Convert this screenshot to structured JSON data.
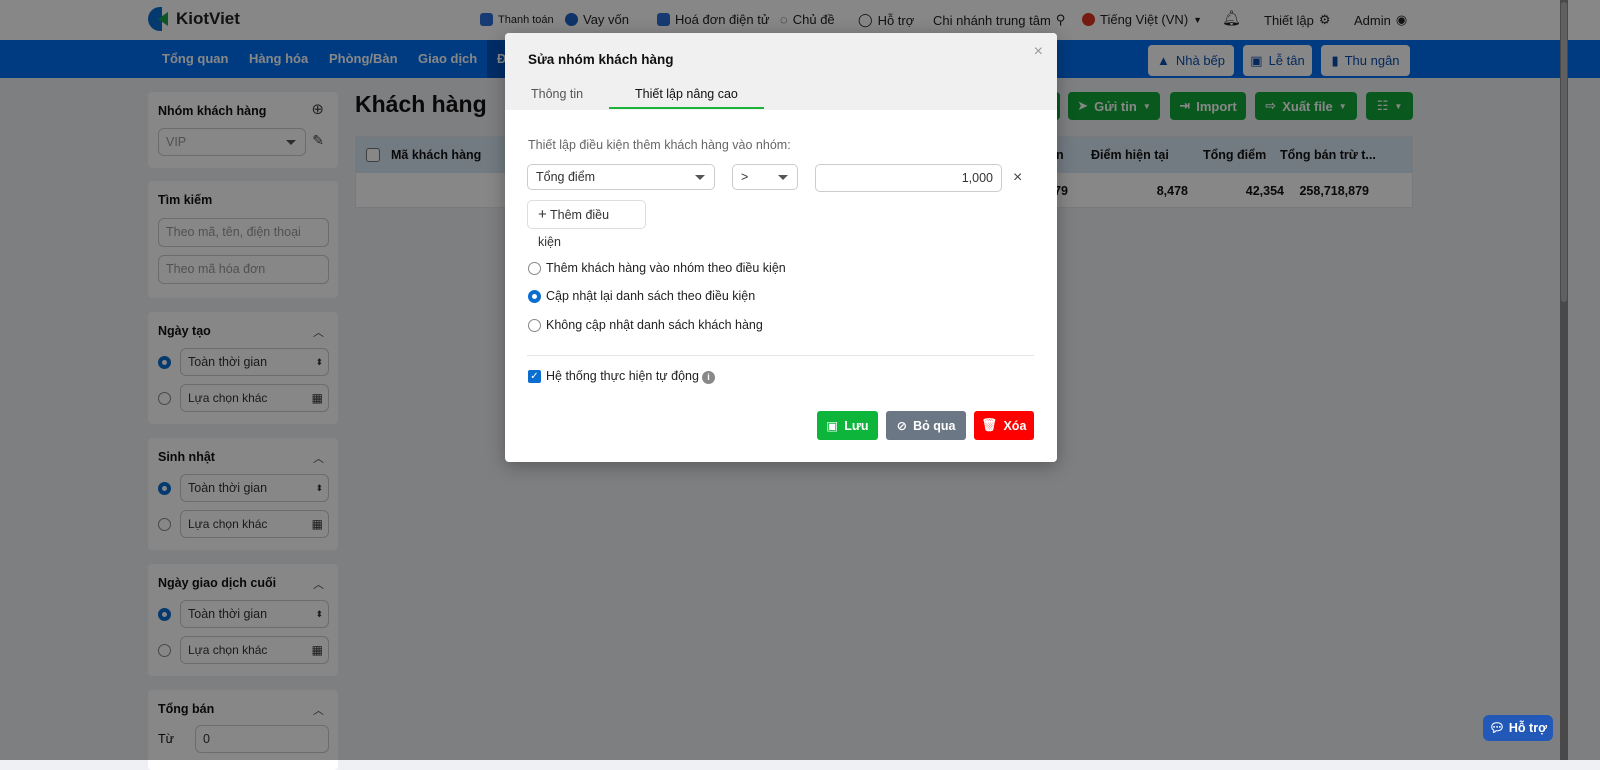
{
  "topbar": {
    "brand": "KiotViet",
    "items": [
      "Thanh toán",
      "Vay vốn",
      "Hoá đơn điện tử",
      "Chủ đề",
      "Hỗ trợ",
      "Chi nhánh trung tâm",
      "Tiếng Việt (VN)",
      "Thiết lập",
      "Admin"
    ]
  },
  "nav": {
    "items": [
      "Tổng quan",
      "Hàng hóa",
      "Phòng/Bàn",
      "Giao dịch",
      "Đ"
    ],
    "buttons": [
      "Nhà bếp",
      "Lễ tân",
      "Thu ngân"
    ]
  },
  "sidebar": {
    "group": {
      "title": "Nhóm khách hàng",
      "value": "VIP"
    },
    "search": {
      "title": "Tìm kiếm",
      "placeholder1": "Theo mã, tên, điện thoại",
      "placeholder2": "Theo mã hóa đơn"
    },
    "filters": [
      {
        "title": "Ngày tạo",
        "opt1": "Toàn thời gian",
        "opt2": "Lựa chọn khác"
      },
      {
        "title": "Sinh nhật",
        "opt1": "Toàn thời gian",
        "opt2": "Lựa chọn khác"
      },
      {
        "title": "Ngày giao dịch cuối",
        "opt1": "Toàn thời gian",
        "opt2": "Lựa chọn khác"
      }
    ],
    "total": {
      "title": "Tổng bán",
      "from_label": "Từ",
      "from_value": "0"
    }
  },
  "main": {
    "title": "Khách hàng",
    "toolbar": [
      "Gửi tin",
      "Import",
      "Xuất file"
    ],
    "columns": [
      "Mã khách hàng",
      "n",
      "Điểm hiện tại",
      "Tổng điểm",
      "Tổng bán trừ t..."
    ],
    "row": [
      "79",
      "8,478",
      "42,354",
      "258,718,879"
    ]
  },
  "modal": {
    "title": "Sửa nhóm khách hàng",
    "close": "×",
    "tabs": [
      "Thông tin",
      "Thiết lập nâng cao"
    ],
    "condition_label": "Thiết lập điều kiện thêm khách hàng vào nhóm:",
    "field": "Tổng điểm",
    "operator": ">",
    "value": "1,000",
    "remove": "×",
    "add_condition": "Thêm điều kiện",
    "options": [
      "Thêm khách hàng vào nhóm theo điều kiện",
      "Cập nhật lại danh sách theo điều kiện",
      "Không cập nhật danh sách khách hàng"
    ],
    "selected_option": 1,
    "auto_label": "Hệ thống thực hiện tự động",
    "auto_checked": true,
    "buttons": {
      "save": "Lưu",
      "skip": "Bỏ qua",
      "delete": "Xóa"
    }
  },
  "help_button": "Hỗ trợ",
  "colors": {
    "brand_blue": "#0070f4",
    "green": "#11a83a",
    "red": "#ff0000",
    "gray": "#6b7785"
  }
}
